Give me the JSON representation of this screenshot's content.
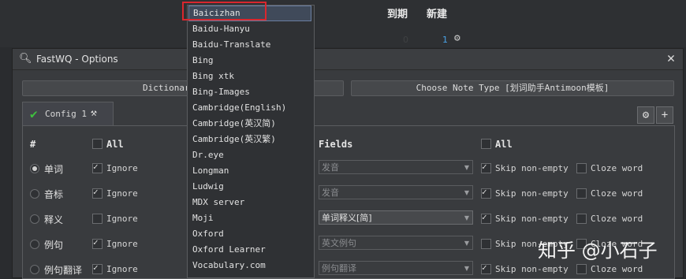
{
  "background_app": {
    "col_due": "到期",
    "col_new": "新建",
    "due_count": "0",
    "new_count": "1",
    "gear_icon": "gear-icon"
  },
  "dialog": {
    "title": "FastWQ - Options",
    "close_icon": "close-icon",
    "dictionary_button": "Dictionary",
    "note_type_button": "Choose Note Type [划词助手Antimoon模板]",
    "config_tab": "Config 1",
    "headers": {
      "num": "#",
      "all_left": "All",
      "fields": "Fields",
      "all_right": "All"
    },
    "rows": [
      {
        "word": "单词",
        "radio": true,
        "ignore_checked": true,
        "ignore": "Ignore",
        "field": "发音",
        "field_active": false,
        "skip_checked": true,
        "skip": "Skip non-empty",
        "cloze": "Cloze word"
      },
      {
        "word": "音标",
        "radio": false,
        "ignore_checked": true,
        "ignore": "Ignore",
        "field": "发音",
        "field_active": false,
        "skip_checked": true,
        "skip": "Skip non-empty",
        "cloze": "Cloze word"
      },
      {
        "word": "释义",
        "radio": false,
        "ignore_checked": false,
        "ignore": "Ignore",
        "field": "单词释义[简]",
        "field_active": true,
        "skip_checked": true,
        "skip": "Skip non-empty",
        "cloze": "Cloze word"
      },
      {
        "word": "例句",
        "radio": false,
        "ignore_checked": true,
        "ignore": "Ignore",
        "field": "英文例句",
        "field_active": false,
        "skip_checked": false,
        "skip": "Skip non-empty",
        "cloze": "Cloze word"
      },
      {
        "word": "例句翻译",
        "radio": false,
        "ignore_checked": true,
        "ignore": "Ignore",
        "field": "例句翻译",
        "field_active": false,
        "skip_checked": true,
        "skip": "Skip non-empty",
        "cloze": "Cloze word"
      }
    ]
  },
  "dropdown": {
    "items": [
      "Baicizhan",
      "Baidu-Hanyu",
      "Baidu-Translate",
      "Bing",
      "Bing xtk",
      "Bing-Images",
      "Cambridge(English)",
      "Cambridge(英汉简)",
      "Cambridge(英汉繁)",
      "Dr.eye",
      "Longman",
      "Ludwig",
      "MDX server",
      "Moji",
      "Oxford",
      "Oxford Learner",
      "Vocabulary.com"
    ],
    "selected": "Baicizhan"
  },
  "watermark": "知乎 @小石子",
  "colors": {
    "highlight": "#d9272e",
    "check_green": "#3fbf3f"
  }
}
